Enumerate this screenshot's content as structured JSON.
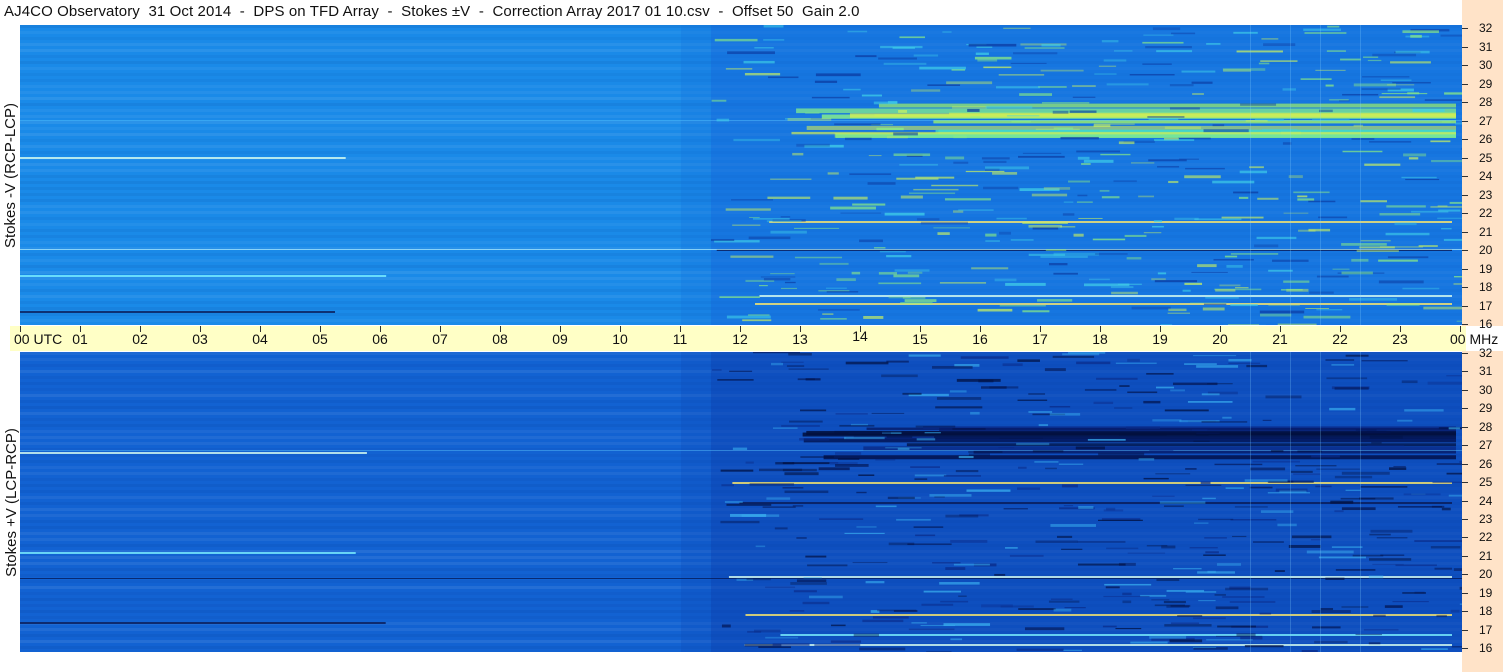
{
  "title": "AJ4CO Observatory  31 Oct 2014  -  DPS on TFD Array  -  Stokes ±V  -  Correction Array 2017 01 10.csv  -  Offset 50  Gain 2.0",
  "panels": {
    "top": {
      "label": "Stokes -V  (RCP-LCP)",
      "base_color": "#1a8ae8",
      "activity_start_hour": 11.5,
      "band_highlight": "yellow-green"
    },
    "bottom": {
      "label": "Stokes +V  (LCP-RCP)",
      "base_color": "#1262d2",
      "activity_start_hour": 11.5,
      "band_highlight": "dark-navy"
    }
  },
  "time_axis": {
    "labels": [
      "00 UTC",
      "01",
      "02",
      "03",
      "04",
      "05",
      "06",
      "07",
      "08",
      "09",
      "10",
      "11",
      "12",
      "13",
      "14",
      "15",
      "16",
      "17",
      "18",
      "19",
      "20",
      "21",
      "22",
      "23",
      "00 MHz"
    ],
    "background": "#ffffc6"
  },
  "frequency_axis": {
    "labels": [
      "32",
      "31",
      "30",
      "29",
      "28",
      "27",
      "26",
      "25",
      "24",
      "23",
      "22",
      "21",
      "20",
      "19",
      "18",
      "17",
      "16"
    ],
    "unit": "MHz",
    "background": "#ffe3c8"
  }
}
